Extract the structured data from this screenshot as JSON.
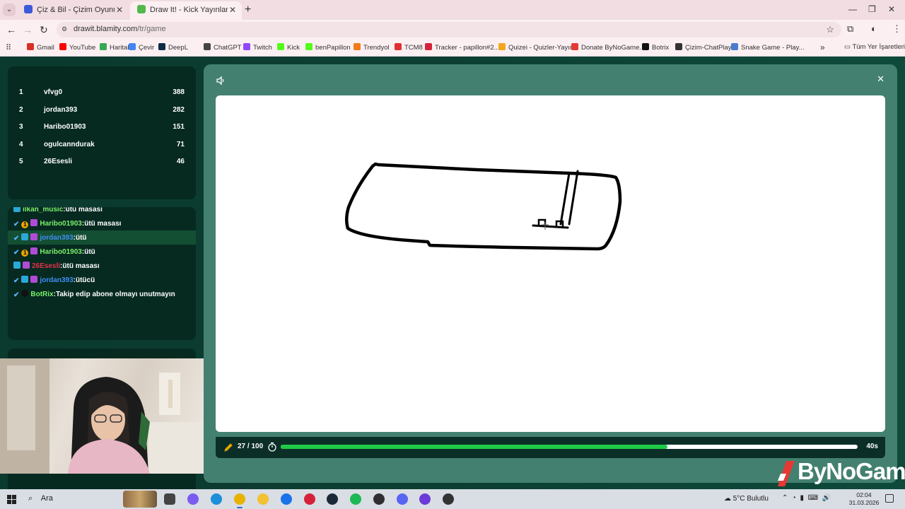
{
  "browser": {
    "tabs": [
      {
        "title": "Çiz & Bil - Çizim Oyunu",
        "active": false,
        "favicon_color": "#3a5bd9"
      },
      {
        "title": "Draw It! - Kick Yayınları İçin Çizim",
        "active": true,
        "favicon_color": "#53b84a"
      }
    ],
    "tab_menu_icon": "chevron-down",
    "new_tab_icon": "+",
    "window_controls": {
      "minimize": "—",
      "maximize": "❐",
      "close": "✕"
    },
    "url_host": "drawit.blamity.com",
    "url_path": "/tr/game",
    "bookmarks": [
      {
        "label": "Gmail",
        "color": "#d93025"
      },
      {
        "label": "YouTube",
        "color": "#ff0000"
      },
      {
        "label": "Haritalar",
        "color": "#34a853"
      },
      {
        "label": "Çevir",
        "color": "#4285f4"
      },
      {
        "label": "DeepL",
        "color": "#0f2b46"
      },
      {
        "label": "ChatGPT",
        "color": "#444444"
      },
      {
        "label": "Twitch",
        "color": "#9146ff"
      },
      {
        "label": "Kick",
        "color": "#53fc18"
      },
      {
        "label": "benPapillon",
        "color": "#53fc18"
      },
      {
        "label": "Trendyol",
        "color": "#f27a1a"
      },
      {
        "label": "TCM8",
        "color": "#e02f2f"
      },
      {
        "label": "Tracker - papillon#2...",
        "color": "#d3223a"
      },
      {
        "label": "Quizei - Quizler-Yayın",
        "color": "#f2a81d"
      },
      {
        "label": "Donate ByNoGame...",
        "color": "#e53935"
      },
      {
        "label": "Botrix",
        "color": "#111111"
      },
      {
        "label": "Çizim-ChatPlay",
        "color": "#333333"
      },
      {
        "label": "Snake Game - Play...",
        "color": "#4a7bd0"
      }
    ],
    "bookmarks_more": "»",
    "all_bookmarks": "Tüm Yer İşaretleri"
  },
  "leaderboard": [
    {
      "rank": "1",
      "name": "vfvg0",
      "score": "388"
    },
    {
      "rank": "2",
      "name": "jordan393",
      "score": "282"
    },
    {
      "rank": "3",
      "name": "Haribo01903",
      "score": "151"
    },
    {
      "rank": "4",
      "name": "ogulcanndurak",
      "score": "71"
    },
    {
      "rank": "5",
      "name": "26Esesli",
      "score": "46"
    }
  ],
  "chat": [
    {
      "user": "ilkan_music",
      "message": "ütü masası",
      "name_color": "green",
      "badges": [
        "grid"
      ]
    },
    {
      "user": "Haribo01903",
      "message": "ütü masası",
      "name_color": "green",
      "badges": [
        "sword",
        "one",
        "gift"
      ]
    },
    {
      "user": "jordan393",
      "message": "ütü",
      "name_color": "blue",
      "badges": [
        "sword",
        "grid",
        "gift"
      ],
      "highlight": true
    },
    {
      "user": "Haribo01903",
      "message": "ütü",
      "name_color": "green",
      "badges": [
        "sword",
        "one",
        "gift"
      ]
    },
    {
      "user": "26Esesli",
      "message": "ütü masası",
      "name_color": "red",
      "badges": [
        "grid",
        "gift"
      ]
    },
    {
      "user": "jordan393",
      "message": "ütücü",
      "name_color": "blue",
      "badges": [
        "sword",
        "grid",
        "gift"
      ]
    },
    {
      "user": "BotRix",
      "message": "Takip edip abone olmayı unutmayın",
      "name_color": "green",
      "badges": [
        "sword",
        "bot"
      ]
    }
  ],
  "game": {
    "round_text": "27 / 100",
    "time_left": "40s",
    "timer_progress": 0.67,
    "accent": "#1fca47",
    "panel_color": "#43806f"
  },
  "watermark": "ByNoGame",
  "taskbar": {
    "search_label": "Ara",
    "weather": "5°C  Bulutlu",
    "time": "02:04",
    "date": "31.03.2026",
    "apps": [
      {
        "name": "task-view",
        "color": "#444444"
      },
      {
        "name": "copilot",
        "color": "#7a5cf0"
      },
      {
        "name": "edge",
        "color": "#1d8fd8"
      },
      {
        "name": "chrome",
        "color": "#e8b300",
        "active": true
      },
      {
        "name": "file-explorer",
        "color": "#f2c230"
      },
      {
        "name": "mail",
        "color": "#1a73e8"
      },
      {
        "name": "opera",
        "color": "#d6213a"
      },
      {
        "name": "steam",
        "color": "#1b2838"
      },
      {
        "name": "spotify",
        "color": "#1db954"
      },
      {
        "name": "obs",
        "color": "#302e31"
      },
      {
        "name": "discord",
        "color": "#5865f2"
      },
      {
        "name": "app-purple",
        "color": "#6b3bd8"
      },
      {
        "name": "app-dark",
        "color": "#333333"
      }
    ]
  }
}
